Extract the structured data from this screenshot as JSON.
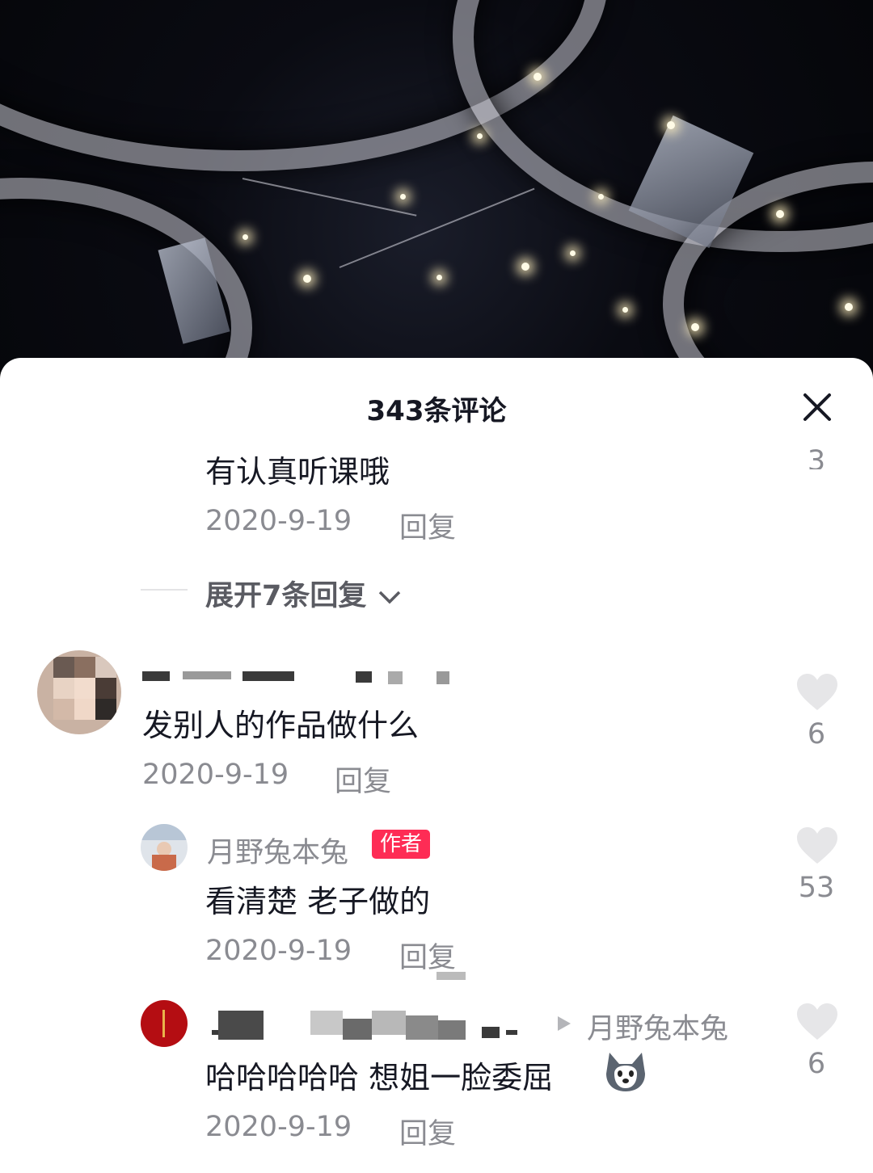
{
  "sheet": {
    "title": "343条评论"
  },
  "top_comment_partial": {
    "text": "有认真听课哦",
    "date": "2020-9-19",
    "reply_label": "回复",
    "like_count": "3"
  },
  "expand": {
    "label": "展开7条回复"
  },
  "comment": {
    "text": "发别人的作品做什么",
    "date": "2020-9-19",
    "reply_label": "回复",
    "like_count": "6"
  },
  "author_reply": {
    "username": "月野兔本兔",
    "badge": "作者",
    "text": "看清楚 老子做的",
    "date": "2020-9-19",
    "reply_label": "回复",
    "like_count": "53"
  },
  "nested_reply": {
    "reply_to": "月野兔本兔",
    "text": "哈哈哈哈哈 想姐一脸委屈",
    "emoji": "husky-emoji",
    "date": "2020-9-19",
    "reply_label": "回复",
    "like_count": "6"
  },
  "colors": {
    "accent": "#fe2c55",
    "primary_text": "#161823",
    "secondary_text": "#8a8b91",
    "heart": "#e6e6e8"
  }
}
